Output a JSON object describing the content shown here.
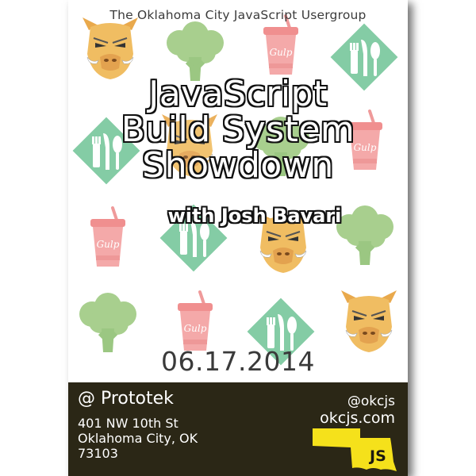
{
  "header": {
    "org_name": "The Oklahoma City JavaScript Usergroup"
  },
  "event": {
    "title_line1": "JavaScript",
    "title_line2": "Build System",
    "title_line3": "Showdown",
    "speaker": "with Josh Bavari",
    "date": "06.17.2014"
  },
  "footer": {
    "venue": "@ Prototek",
    "address_line1": "401 NW 10th St",
    "address_line2": "Oklahoma City, OK",
    "address_line3": "73103",
    "twitter": "@okcjs",
    "website": "okcjs.com",
    "logo_text": "JS"
  },
  "decor": {
    "cup_label": "Gulp",
    "icons": [
      "grunt-boar-icon",
      "broccoli-icon",
      "gulp-cup-icon",
      "fork-knife-spoon-icon"
    ]
  },
  "colors": {
    "background": "#ffffff",
    "footer_bg": "#2b2716",
    "oklahoma_yellow": "#f5e11b",
    "broccoli_green": "#a8cf8e",
    "gulp_pink": "#f2a3a3",
    "diamond_green": "#7fcaa2",
    "boar_orange": "#efb95d"
  }
}
